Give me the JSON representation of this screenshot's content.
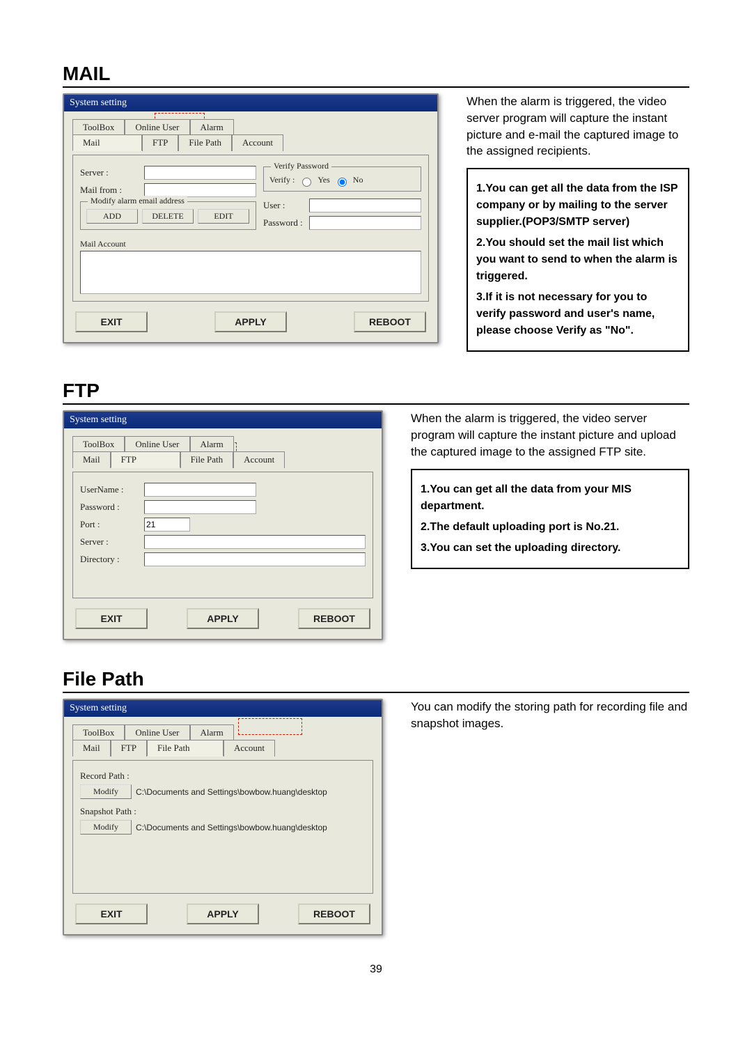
{
  "page_number": "39",
  "sections": {
    "mail": {
      "title": "MAIL",
      "dialog_title": "System setting",
      "tabs_top": [
        "ToolBox",
        "Online User",
        "Alarm"
      ],
      "tabs_bottom": [
        "Mail",
        "FTP",
        "File Path",
        "Account"
      ],
      "active_tab": "Mail",
      "labels": {
        "server": "Server :",
        "mail_from": "Mail from :",
        "legend_modify": "Modify alarm email address",
        "user": "User :",
        "password": "Password :",
        "mail_account": "Mail Account",
        "legend_verify": "Verify Password",
        "verify": "Verify :",
        "yes": "Yes",
        "no": "No"
      },
      "buttons": {
        "add": "ADD",
        "delete": "DELETE",
        "edit": "EDIT",
        "exit": "EXIT",
        "apply": "APPLY",
        "reboot": "REBOOT"
      },
      "desc": "When the alarm is triggered, the video server program will capture the instant picture and e-mail the captured image to the assigned recipients.",
      "info": [
        "1.You can get all the data from the ISP company or by mailing to the server supplier.(POP3/SMTP server)",
        "2.You should set the mail list which you want to send to when the alarm is triggered.",
        "3.If it is not necessary for you to verify password and user's name, please choose Verify as \"No\"."
      ]
    },
    "ftp": {
      "title": "FTP",
      "dialog_title": "System setting",
      "tabs_top": [
        "ToolBox",
        "Online User",
        "Alarm"
      ],
      "tabs_bottom": [
        "Mail",
        "FTP",
        "File Path",
        "Account"
      ],
      "active_tab": "FTP",
      "labels": {
        "username": "UserName :",
        "password": "Password :",
        "port": "Port :",
        "server": "Server  :",
        "directory": "Directory :"
      },
      "values": {
        "port": "21"
      },
      "buttons": {
        "exit": "EXIT",
        "apply": "APPLY",
        "reboot": "REBOOT"
      },
      "desc": "When the alarm is triggered, the video server program will capture the instant picture and upload the captured image to the assigned FTP site.",
      "info": [
        "1.You can get all the data from your MIS department.",
        "2.The default uploading port is No.21.",
        "3.You can set the uploading directory."
      ]
    },
    "filepath": {
      "title": "File Path",
      "dialog_title": "System setting",
      "tabs_top": [
        "ToolBox",
        "Online User",
        "Alarm"
      ],
      "tabs_bottom": [
        "Mail",
        "FTP",
        "File Path",
        "Account"
      ],
      "active_tab": "File Path",
      "labels": {
        "record_path": "Record Path :",
        "snapshot_path": "Snapshot Path :",
        "modify": "Modify"
      },
      "values": {
        "record_path": "C:\\Documents and Settings\\bowbow.huang\\desktop",
        "snapshot_path": "C:\\Documents and Settings\\bowbow.huang\\desktop"
      },
      "buttons": {
        "exit": "EXIT",
        "apply": "APPLY",
        "reboot": "REBOOT"
      },
      "desc": "You can modify the storing path for recording file and snapshot images."
    }
  }
}
